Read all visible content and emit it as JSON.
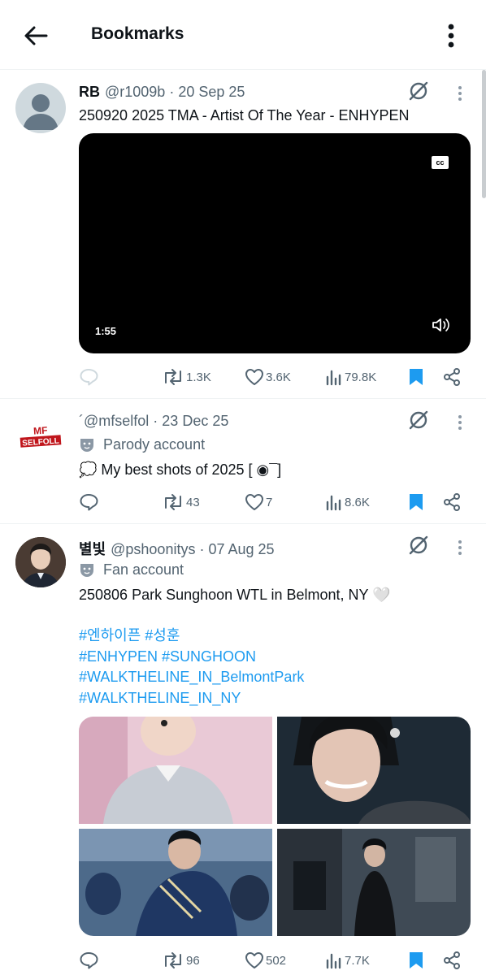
{
  "header": {
    "title": "Bookmarks",
    "back_icon": "arrow-left-icon",
    "more_icon": "more-vertical-icon"
  },
  "colors": {
    "accent": "#1d9bf0",
    "text": "#0f1419",
    "muted": "#536471",
    "divider": "#eff3f4"
  },
  "posts": [
    {
      "name": "RB",
      "handle": "@r1009b",
      "date": "20 Sep 25",
      "text": "250920 2025 TMA - Artist Of The Year - ENHYPEN",
      "video": {
        "cc": "cc",
        "duration": "1:55"
      },
      "actions": {
        "replies": "",
        "reposts": "1.3K",
        "likes": "3.6K",
        "views": "79.8K"
      }
    },
    {
      "name": "",
      "handle": "@mfselfol",
      "date": "23 Dec 25",
      "badge": "Parody account",
      "avatar_logo": "MF SELFOLL",
      "text": "💭 My best shots of 2025 [ ◉¯]",
      "actions": {
        "replies": "",
        "reposts": "43",
        "likes": "7",
        "views": "8.6K"
      }
    },
    {
      "name": "별빛",
      "handle": "@pshoonitys",
      "date": "07 Aug 25",
      "badge": "Fan account",
      "text": "250806 Park Sunghoon WTL in Belmont, NY 🤍",
      "hashtags": [
        "#엔하이픈 #성훈",
        "#ENHYPEN #SUNGHOON",
        "#WALKTHELINE_IN_BelmontPark",
        "#WALKTHELINE_IN_NY"
      ],
      "actions": {
        "replies": "",
        "reposts": "96",
        "likes": "502",
        "views": "7.7K"
      }
    }
  ]
}
